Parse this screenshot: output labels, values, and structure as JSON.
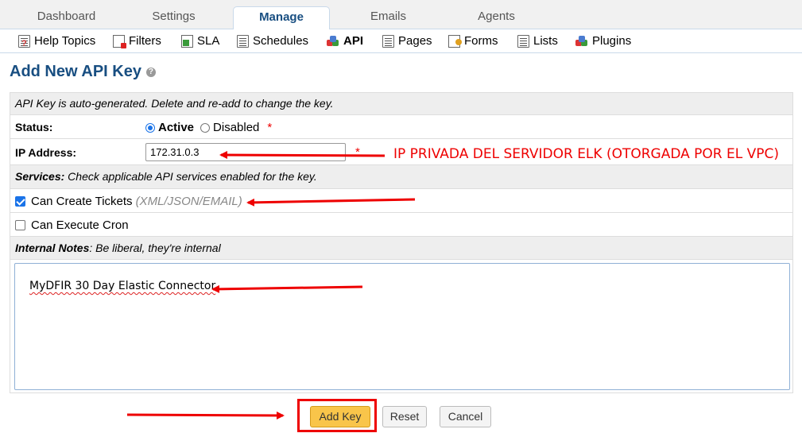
{
  "tabs": [
    {
      "label": "Dashboard"
    },
    {
      "label": "Settings"
    },
    {
      "label": "Manage"
    },
    {
      "label": "Emails"
    },
    {
      "label": "Agents"
    }
  ],
  "subnav": [
    {
      "label": "Help Topics",
      "icon": "help-topics-icon"
    },
    {
      "label": "Filters",
      "icon": "filters-icon"
    },
    {
      "label": "SLA",
      "icon": "sla-icon"
    },
    {
      "label": "Schedules",
      "icon": "schedules-icon"
    },
    {
      "label": "API",
      "icon": "api-icon"
    },
    {
      "label": "Pages",
      "icon": "pages-icon"
    },
    {
      "label": "Forms",
      "icon": "forms-icon"
    },
    {
      "label": "Lists",
      "icon": "lists-icon"
    },
    {
      "label": "Plugins",
      "icon": "plugins-icon"
    }
  ],
  "page_title": "Add New API Key",
  "form": {
    "intro": "API Key is auto-generated. Delete and re-add to change the key.",
    "status_label": "Status:",
    "status_active": "Active",
    "status_disabled": "Disabled",
    "required_mark": "*",
    "ip_label": "IP Address:",
    "ip_value": "172.31.0.3",
    "services_bold": "Services:",
    "services_text": "Check applicable API services enabled for the key.",
    "can_create_tickets": "Can Create Tickets",
    "can_create_tickets_hint": "(XML/JSON/EMAIL)",
    "can_execute_cron": "Can Execute Cron",
    "notes_bold": "Internal Notes",
    "notes_text": ": Be liberal, they're internal",
    "notes_value": "MyDFIR 30 Day Elastic Connector"
  },
  "buttons": {
    "add": "Add Key",
    "reset": "Reset",
    "cancel": "Cancel"
  },
  "annotation": "IP PRIVADA DEL SERVIDOR ELK (OTORGADA POR EL VPC)",
  "colors": {
    "accent": "#184e81",
    "annotation": "#e00000",
    "primary_button": "#f9c54a"
  }
}
